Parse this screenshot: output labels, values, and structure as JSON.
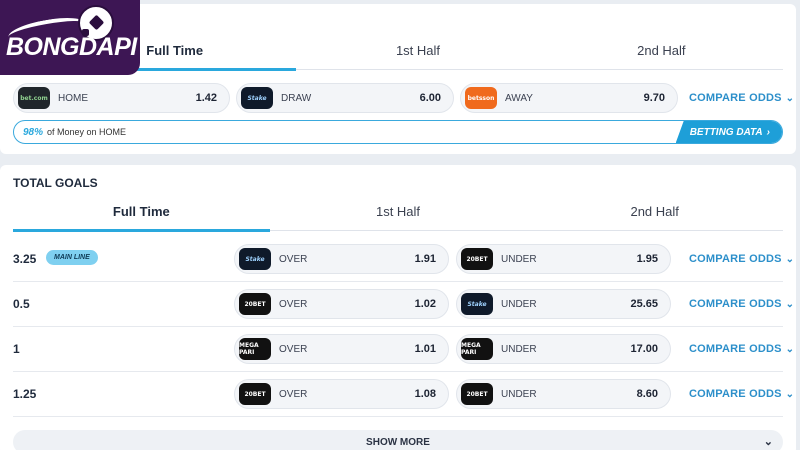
{
  "logo": {
    "text": "BONGDAPI"
  },
  "match_odds": {
    "tabs": [
      "Full Time",
      "1st Half",
      "2nd Half"
    ],
    "options": [
      {
        "bookmaker": "bet.com",
        "label": "HOME",
        "odds": "1.42"
      },
      {
        "bookmaker": "Stake",
        "label": "DRAW",
        "odds": "6.00"
      },
      {
        "bookmaker": "betsson",
        "label": "AWAY",
        "odds": "9.70"
      }
    ],
    "compare_label": "COMPARE ODDS",
    "money": {
      "percent": "98%",
      "text": "of Money on HOME",
      "button": "BETTING DATA"
    }
  },
  "total_goals": {
    "title": "TOTAL GOALS",
    "tabs": [
      "Full Time",
      "1st Half",
      "2nd Half"
    ],
    "main_line_badge": "MAIN LINE",
    "compare_label": "COMPARE ODDS",
    "rows": [
      {
        "line": "3.25",
        "over_book": "Stake",
        "over_label": "OVER",
        "over_odds": "1.91",
        "under_book": "20BET",
        "under_label": "UNDER",
        "under_odds": "1.95"
      },
      {
        "line": "0.5",
        "over_book": "20BET",
        "over_label": "OVER",
        "over_odds": "1.02",
        "under_book": "Stake",
        "under_label": "UNDER",
        "under_odds": "25.65"
      },
      {
        "line": "1",
        "over_book": "MEGA PARI",
        "over_label": "OVER",
        "over_odds": "1.01",
        "under_book": "MEGA PARI",
        "under_label": "UNDER",
        "under_odds": "17.00"
      },
      {
        "line": "1.25",
        "over_book": "20BET",
        "over_label": "OVER",
        "over_odds": "1.08",
        "under_book": "20BET",
        "under_label": "UNDER",
        "under_odds": "8.60"
      }
    ],
    "show_more": "SHOW MORE"
  },
  "icons": {
    "chevron": "chevron-down-icon",
    "arrow": "chevron-right-icon",
    "logo_ball": "soccer-ball-icon"
  },
  "colors": {
    "accent": "#2aa8dd",
    "logo_bg": "#3d1654",
    "link": "#2c8fca"
  }
}
